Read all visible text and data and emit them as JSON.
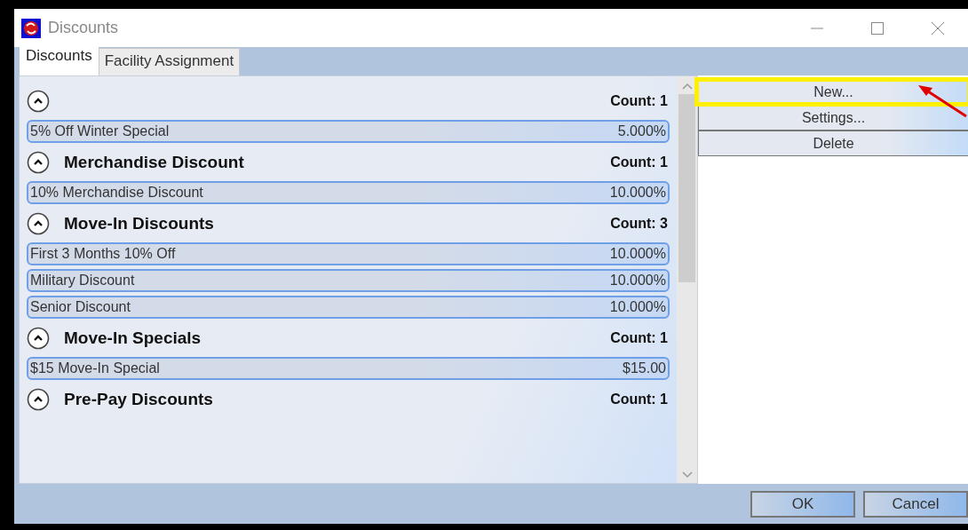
{
  "window": {
    "title": "Discounts"
  },
  "tabs": [
    {
      "label": "Discounts",
      "selected": true
    },
    {
      "label": "Facility Assignment",
      "selected": false
    }
  ],
  "groups": [
    {
      "expanded": true,
      "count": "Count: 1",
      "items": [
        {
          "name": "5% Off Winter Special",
          "value": "5.000%"
        }
      ]
    },
    {
      "title": "Merchandise Discount",
      "expanded": true,
      "count": "Count: 1",
      "items": [
        {
          "name": "10% Merchandise Discount",
          "value": "10.000%"
        }
      ]
    },
    {
      "title": "Move-In Discounts",
      "expanded": true,
      "count": "Count: 3",
      "items": [
        {
          "name": "First 3 Months 10% Off",
          "value": "10.000%"
        },
        {
          "name": "Military Discount",
          "value": "10.000%"
        },
        {
          "name": "Senior Discount",
          "value": "10.000%"
        }
      ]
    },
    {
      "title": "Move-In Specials",
      "expanded": true,
      "count": "Count: 1",
      "items": [
        {
          "name": "$15 Move-In Special",
          "value": "$15.00"
        }
      ]
    },
    {
      "title": "Pre-Pay Discounts",
      "expanded": true,
      "count": "Count: 1"
    }
  ],
  "actions": [
    {
      "label": "New...",
      "highlighted": true
    },
    {
      "label": "Settings...",
      "highlighted": false
    },
    {
      "label": "Delete",
      "highlighted": false
    }
  ],
  "buttons": [
    "OK",
    "Cancel"
  ]
}
